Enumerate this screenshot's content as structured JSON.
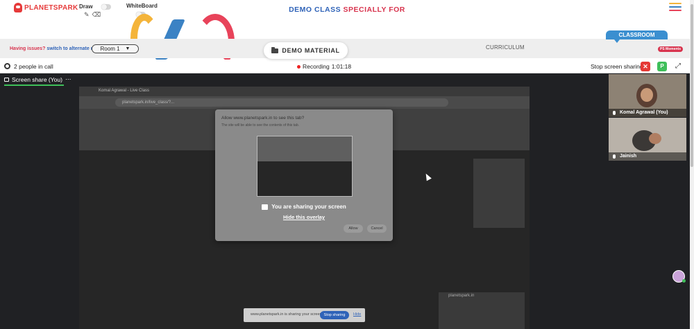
{
  "header": {
    "logo": "PLANETSPARK",
    "draw_label": "Draw",
    "whiteboard_label": "WhiteBoard",
    "title_part1": "DEMO CLASS",
    "title_part2": "SPECIALLY FOR",
    "hamburger_colors": [
      "#f4b43a",
      "#3b82c4",
      "#e8435a"
    ]
  },
  "strip": {
    "issues_text": "Having issues?",
    "issues_link": "switch to alternate room",
    "room": "Room 1",
    "demo_material": "DEMO MATERIAL",
    "curriculum": "CURRICULUM",
    "classroom": "CLASSROOM",
    "ps_moments": "PS Moments"
  },
  "callbar": {
    "people": "2 people in call",
    "recording_label": "Recording",
    "recording_time": "1:01:18",
    "stop_sharing": "Stop screen sharing",
    "p_label": "P"
  },
  "stage": {
    "share_tab": "Screen share (You)",
    "share_menu": "⋯"
  },
  "shared_screen": {
    "tab_text": "Komal Agrawal - Live Class",
    "url": "planetspark.in/live_class/?...",
    "cam_label": "planetspark.in",
    "banner_msg": "www.planetspark.in is sharing your screen.",
    "banner_stop": "Stop sharing",
    "banner_hide": "Hide"
  },
  "dialog": {
    "question": "Allow www.planetspark.in to see this tab?",
    "subtitle": "The site will be able to see the contents of this tab.",
    "sharing": "You are sharing your screen",
    "hide_overlay": "Hide this overlay",
    "allow": "Allow",
    "cancel": "Cancel"
  },
  "participants": [
    {
      "name": "Komal Agrawal (You)"
    },
    {
      "name": "Jainish"
    }
  ],
  "colors": {
    "brand_red": "#d8344e",
    "brand_blue": "#2f63b8",
    "stage_bg": "#202124",
    "accent_green": "#3fbf5a"
  }
}
